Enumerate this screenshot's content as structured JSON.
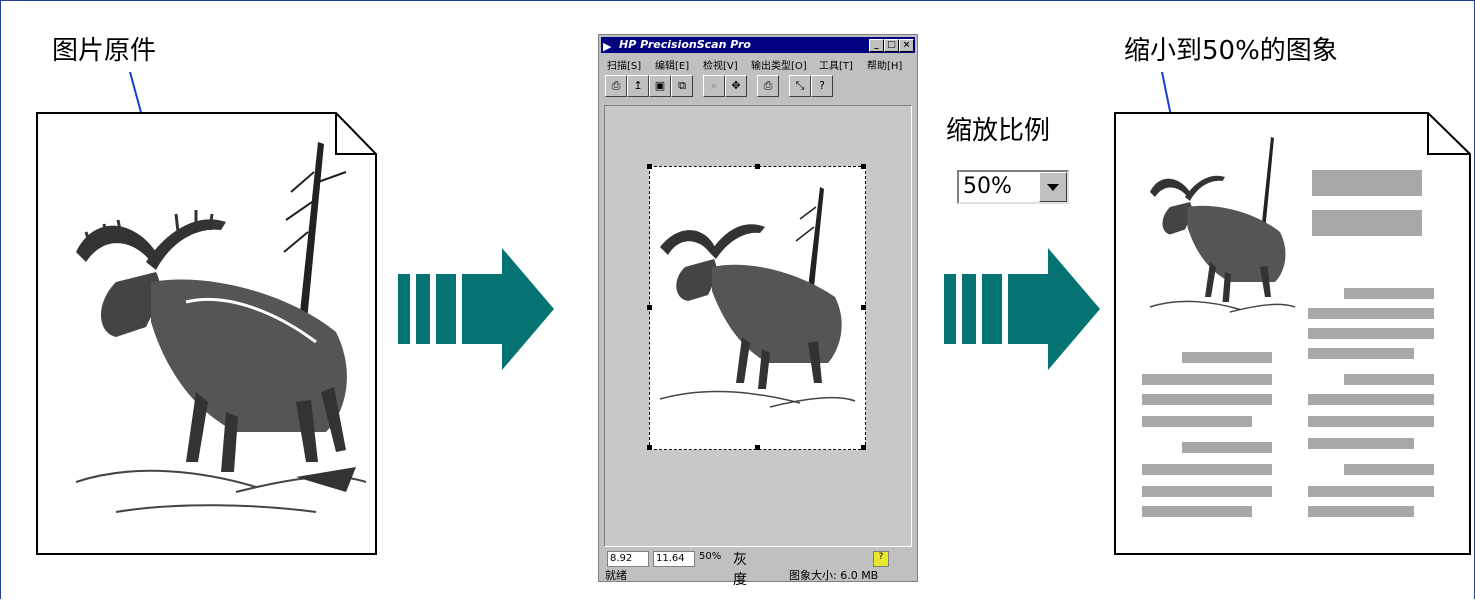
{
  "labels": {
    "original": "图片原件",
    "scaled": "缩小到50%的图象",
    "scale_ratio": "缩放比例"
  },
  "scale_combo": {
    "value": "50%"
  },
  "hp_window": {
    "title": "HP PrecisionScan Pro",
    "menu": [
      "扫描[S]",
      "编辑[E]",
      "检视[V]",
      "输出类型[O]",
      "工具[T]",
      "帮助[H]"
    ],
    "toolbar_icons": [
      "scan-icon",
      "prescan-icon",
      "save-icon",
      "copy-icon",
      "zoom-icon",
      "move-icon",
      "print-icon",
      "resize-icon",
      "help-icon"
    ],
    "width_value": "8.92",
    "height_value": "11.64",
    "zoom": "50%",
    "mode": "灰度",
    "status": "就绪",
    "image_size": "图象大小: 6.0 MB"
  },
  "colors": {
    "arrow": "#047371",
    "border": "#1f3fa0",
    "pointer": "#1a3fd0",
    "text_placeholder": "#a8a8a8"
  }
}
